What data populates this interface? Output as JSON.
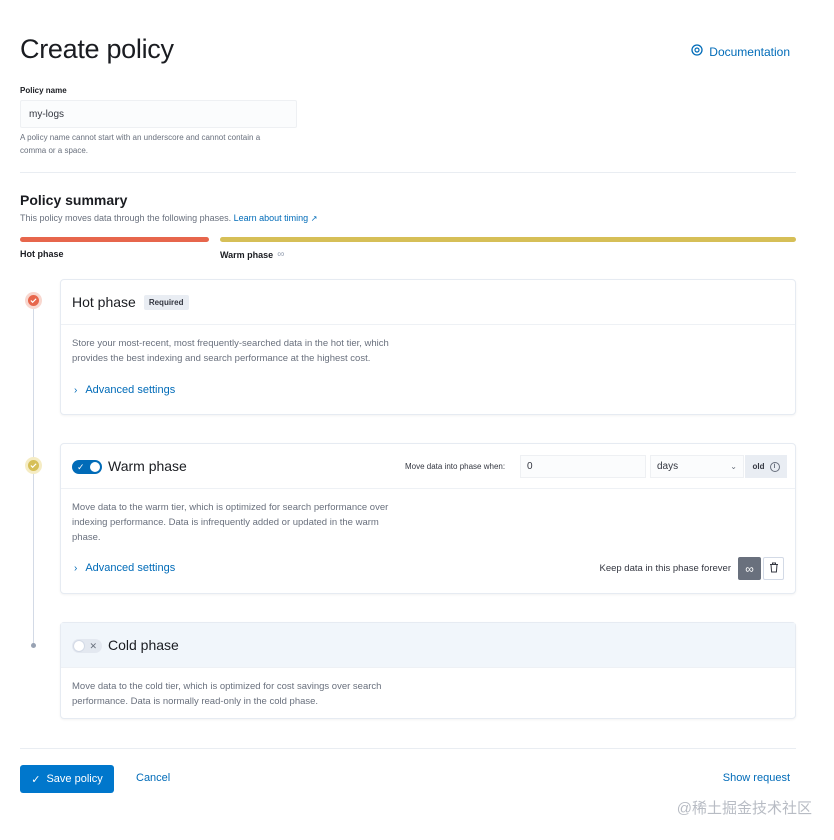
{
  "header": {
    "title": "Create policy",
    "documentation_label": "Documentation"
  },
  "policy_name": {
    "label": "Policy name",
    "value": "my-logs",
    "help_line1": "A policy name cannot start with an underscore and cannot contain a",
    "help_line2": "comma or a space."
  },
  "summary": {
    "title": "Policy summary",
    "description": "This policy moves data through the following phases.",
    "learn_link": "Learn about timing",
    "hot_label": "Hot phase",
    "warm_label": "Warm phase",
    "colors": {
      "hot": "#e7664c",
      "warm": "#d6bf57"
    }
  },
  "hot_phase": {
    "title": "Hot phase",
    "badge": "Required",
    "desc_line1": "Store your most-recent, most frequently-searched data in the hot tier, which",
    "desc_line2": "provides the best indexing and search performance at the highest cost.",
    "advanced": "Advanced settings"
  },
  "warm_phase": {
    "title": "Warm phase",
    "enabled": true,
    "move_label": "Move data into phase when:",
    "min_age": "0",
    "unit": "days",
    "unit_suffix": "old",
    "desc_line1": "Move data to the warm tier, which is optimized for search performance over",
    "desc_line2": "indexing performance. Data is infrequently added or updated in the warm",
    "desc_line3": "phase.",
    "advanced": "Advanced settings",
    "keep_label": "Keep data in this phase forever"
  },
  "cold_phase": {
    "title": "Cold phase",
    "enabled": false,
    "desc_line1": "Move data to the cold tier, which is optimized for cost savings over search",
    "desc_line2": "performance. Data is normally read-only in the cold phase."
  },
  "footer": {
    "save": "Save policy",
    "cancel": "Cancel",
    "show_request": "Show request"
  },
  "watermark": "@稀土掘金技术社区"
}
